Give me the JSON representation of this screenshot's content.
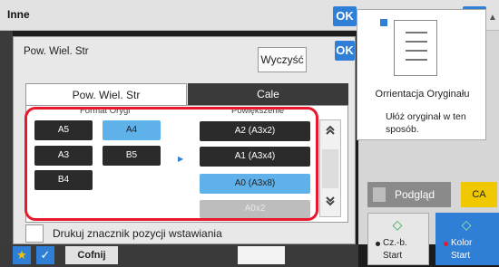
{
  "header": {
    "title": "Inne",
    "ok_label": "OK",
    "ok_right_label": "OK",
    "scroll_up_glyph": "▲"
  },
  "dialog": {
    "title": "Pow. Wiel. Str",
    "clear_label": "Wyczyść",
    "ok_label": "OK",
    "tabs": [
      {
        "label": "Pow. Wiel. Str"
      },
      {
        "label": "Cale"
      }
    ],
    "format_label": "Format Orygi",
    "zoom_label": "Powiększenie",
    "original_sizes": [
      {
        "label": "A5",
        "selected": false
      },
      {
        "label": "A4",
        "selected": true
      },
      {
        "label": "A3",
        "selected": false
      },
      {
        "label": "B5",
        "selected": false
      },
      {
        "label": "B4",
        "selected": false
      }
    ],
    "arrow_glyph": "▶",
    "enlargements": [
      {
        "label": "A2 (A3x2)",
        "selected": false
      },
      {
        "label": "A1 (A3x4)",
        "selected": false
      },
      {
        "label": "A0 (A3x8)",
        "selected": true
      },
      {
        "label": "A0x2",
        "selected": false,
        "disabled": true
      }
    ],
    "scroll_up_glyph": "⯭",
    "scroll_down_glyph": "⯯",
    "checkbox_label": "Drukuj znacznik pozycji wstawiania",
    "checkbox_checked": false
  },
  "orientation": {
    "label": "Orrientacja Oryginału",
    "note": "Ułóż oryginał w ten sposób."
  },
  "bottom": {
    "star_glyph": "★",
    "check_glyph": "✓",
    "back_label": "Cofnij",
    "preview_label": "Podgląd",
    "ca_label": "CA",
    "start_bw": {
      "icon": "◇",
      "line1": "Cz.-b.",
      "line2": "Start"
    },
    "start_color": {
      "icon": "◇",
      "line1": "Kolor",
      "line2": "Start"
    }
  },
  "colors": {
    "accent": "#2f7fd6",
    "selected": "#5fb1ea",
    "highlight": "#e8192c",
    "ca": "#f0c800"
  }
}
